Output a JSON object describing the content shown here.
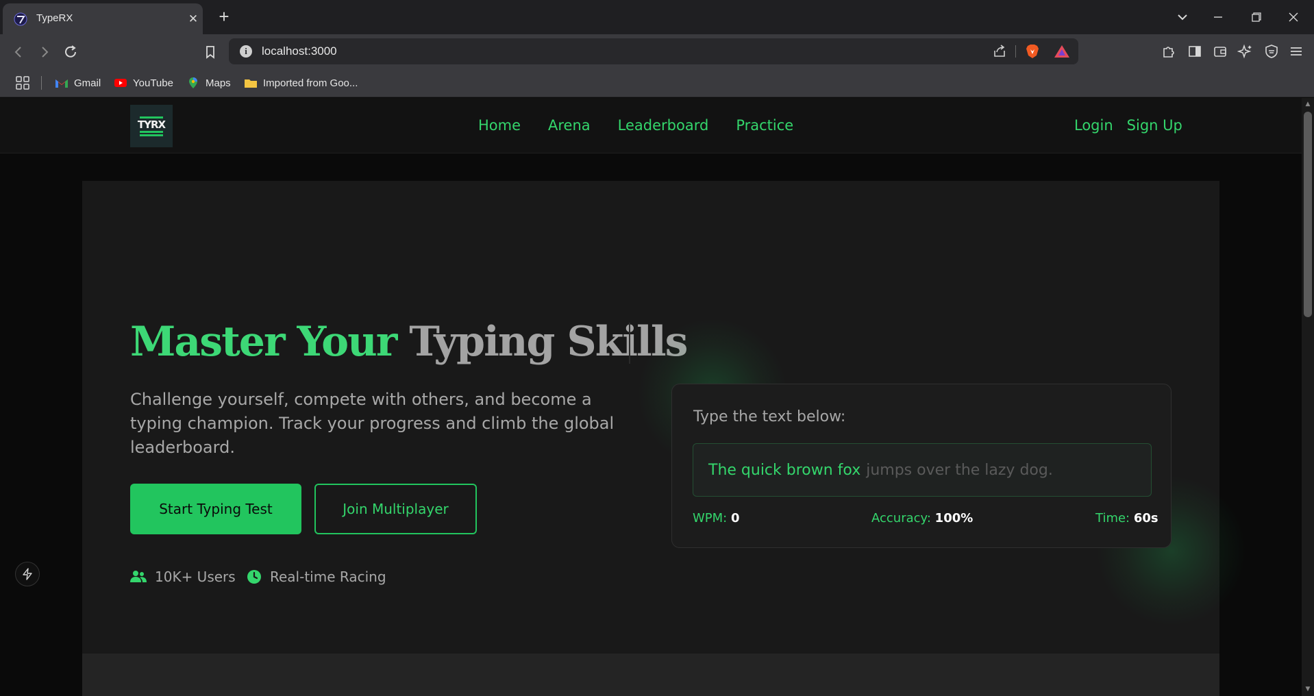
{
  "browser": {
    "tab_title": "TypeRX",
    "tab_close": "✕",
    "new_tab": "+",
    "url": "localhost:3000",
    "bookmarks": [
      "Gmail",
      "YouTube",
      "Maps",
      "Imported from Goo..."
    ]
  },
  "site": {
    "logo_text": "TYRX",
    "nav": [
      "Home",
      "Arena",
      "Leaderboard",
      "Practice"
    ],
    "auth": {
      "login": "Login",
      "signup": "Sign Up"
    }
  },
  "hero": {
    "title_accent": "Master Your",
    "title_rest": "Typing Skills",
    "subtitle": "Challenge yourself, compete with others, and become a typing champion. Track your progress and climb the global leaderboard.",
    "primary_button": "Start Typing Test",
    "secondary_button": "Join Multiplayer",
    "stats": [
      {
        "icon": "users-icon",
        "label": "10K+ Users"
      },
      {
        "icon": "clock-icon",
        "label": "Real-time Racing"
      }
    ]
  },
  "typing_card": {
    "label": "Type the text below:",
    "typed_text": "The quick brown fox",
    "untyped_text": "jumps over the lazy dog.",
    "wpm_label": "WPM:",
    "wpm_value": "0",
    "accuracy_label": "Accuracy:",
    "accuracy_value": "100%",
    "time_label": "Time:",
    "time_value": "60s"
  },
  "colors": {
    "accent": "#22c55e",
    "accent_text": "#34d66c",
    "background": "#0a0a0a",
    "card": "#191919"
  }
}
